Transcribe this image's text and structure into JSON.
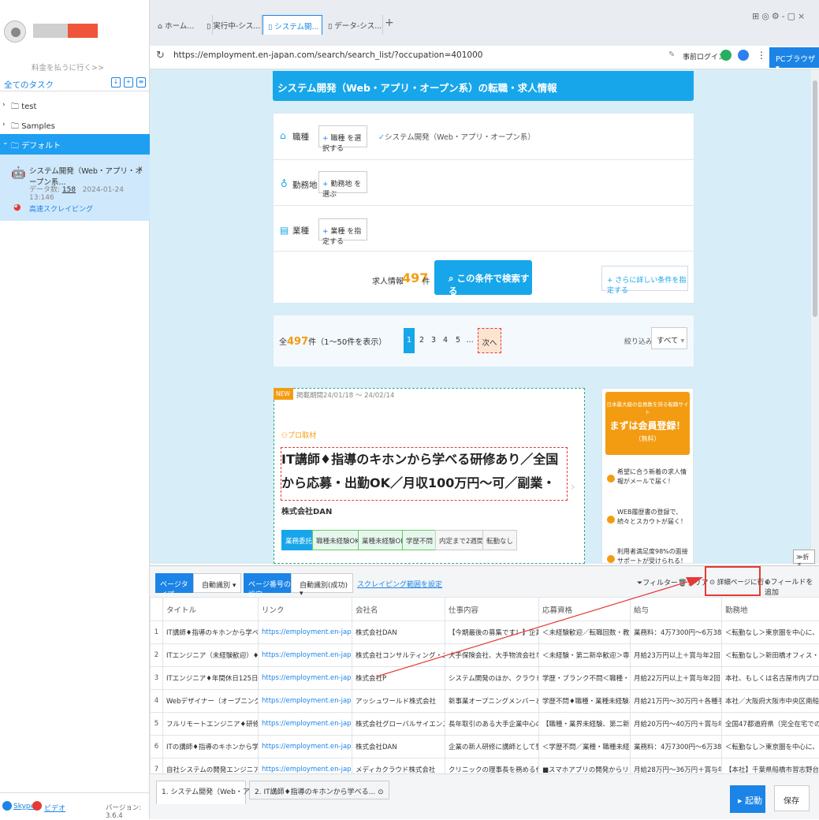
{
  "sidebar": {
    "pay_text": "料金を払うに行く>>",
    "all_tasks": "全てのタスク",
    "tree": [
      {
        "label": "test",
        "open": false
      },
      {
        "label": "Samples",
        "open": false
      },
      {
        "label": "デフォルト",
        "open": true
      }
    ],
    "task": {
      "title": "システム開発（Web・アプリ・オープン系...",
      "data_label": "データ数:",
      "data_count": "158",
      "date": "2024-01-24 13:146",
      "link": "高速スクレイピング"
    },
    "footer": {
      "skype": "Skype",
      "video": "ビデオ",
      "version": "バージョン: 3.6.4"
    }
  },
  "tabs": [
    {
      "label": "ホーム..."
    },
    {
      "label": "実行中-シス..."
    },
    {
      "label": "システム開..."
    },
    {
      "label": "データ-シス..."
    }
  ],
  "address": {
    "url": "https://employment.en-japan.com/search/search_list/?occupation=401000",
    "login": "事前ログイン",
    "browser": "PCブラウザ"
  },
  "web": {
    "title": "システム開発（Web・アプリ・オープン系）の転職・求人情報",
    "row1_label": "職種",
    "row1_btn": "職種 を選択する",
    "row1_selected": "システム開発（Web・アプリ・オープン系）",
    "row2_label": "勤務地",
    "row2_btn": "勤務地 を選ぶ",
    "row3_label": "業種",
    "row3_btn": "業種 を指定する",
    "count_label": "求人情報",
    "count": "497",
    "count_unit": "件",
    "search_btn": "この条件で検索する",
    "more_btn": "さらに詳しい条件を指定する",
    "total_prefix": "全",
    "total": "497",
    "total_suffix": "件（1～50件を表示）",
    "pages": [
      "1",
      "2",
      "3",
      "4",
      "5",
      "…",
      "次へ"
    ],
    "filter_label": "絞り込み：",
    "filter_value": "すべて",
    "new_badge": "NEW",
    "period": "掲載期間24/01/18 ～ 24/02/14",
    "pro": "プロ取材",
    "job_title": "IT講師♦指導のキホンから学べる研修あり／全国から応募・出勤OK／月収100万円～可／副業・兼業OK",
    "company": "株式会社DAN",
    "chips": [
      "業務委託",
      "職種未経験OK",
      "業種未経験OK",
      "学歴不問",
      "内定まで2週間",
      "転勤なし"
    ],
    "ad": {
      "top": "日本最大級の会員数を誇る転職サイト",
      "main": "まずは会員登録！",
      "free": "（無料）",
      "p1": "希望に合う新着の求人情報がメールで届く！",
      "p2": "WEB履歴書の登録で、続々とスカウトが届く！",
      "p3": "利用者満足度98%の面接サポートが受けられる！"
    },
    "collapse": "折る"
  },
  "toolbar": {
    "page_type_label": "ページタイプ",
    "page_type_value": "自動識別",
    "page_num_label": "ページ番号の設定",
    "page_num_value": "自動識別(成功)",
    "scrape_range": "スクレイピング範囲を設定",
    "filter": "フィルター",
    "clear": "クリア",
    "detail": "詳細ページに行く",
    "add_field": "フィールドを追加"
  },
  "table": {
    "columns": [
      "タイトル",
      "リンク",
      "会社名",
      "仕事内容",
      "応募資格",
      "給与",
      "勤務地"
    ],
    "rows": [
      [
        "1",
        "IT講師♦指導のキホンから学べる研修...",
        "https://employment.en-japan.com/de...",
        "株式会社DAN",
        "【今期最後の募集です！】企業の新...",
        "＜未経験歓迎／転職回数・教育ブラ...",
        "業務料：4万7300円～6万3800円／...",
        "＜転勤なし＞東京圏を中心に、大阪..."
      ],
      [
        "2",
        "ITエンジニア（未経験歓迎）♦充実の...",
        "https://employment.en-japan.com/de...",
        "株式会社コンサルティング・エムア...",
        "大手保険会社、大手物流会社などの...",
        "＜未経験・第二新卒歓迎＞専門や以...",
        "月給23万円以上＋賞与年2回＋各種手...",
        "＜転勤なし＞新田橋オフィス・小川..."
      ],
      [
        "3",
        "ITエンジニア♦年間休日125日／リモ...",
        "https://employment.en-japan.com/de...",
        "株式会社P",
        "システム開発のほか、クラウド構築...",
        "学歴・ブランク不問＜職種・業種未...",
        "月給22万円以上＋賞与年2回＋各種...",
        "本社、もしくは名古屋市内プロジェ..."
      ],
      [
        "4",
        "Webデザイナー（オープニング募集...",
        "https://employment.en-japan.com/de...",
        "アッシュワールド株式会社",
        "新事業オープニングメンバーとして...",
        "学歴不問♦職種・業種未経験、社会人...",
        "月給21万円～30万円＋各種手当 ※...",
        "本社／大阪府大阪市中央区南船場3-7..."
      ],
      [
        "5",
        "フルリモートエンジニア♦研修もリモ...",
        "https://employment.en-japan.com/de...",
        "株式会社グローバルサイエンス",
        "長年取引のある大手企業中心のシス...",
        "【職種・業界未経験、第二新卒歓迎...",
        "月給20万円～40万円＋賞与年3回＋...",
        "全国47都道府県（完全在宅での勤務..."
      ],
      [
        "6",
        "ITの講師♦指導のキホンから学べる研...",
        "https://employment.en-japan.com/de...",
        "株式会社DAN",
        "企業の新人研修に講師として登壇し...",
        "＜学歴不問／業種・職種未経験、第...",
        "業務料：4万7300円～6万3800円／...",
        "＜転勤なし＞東京圏を中心に、大阪..."
      ],
      [
        "7",
        "自社システムの開発エンジニア♦年間...",
        "https://employment.en-japan.com/de...",
        "メディカクラウド株式会社",
        "クリニックの理事長を務める代表が...",
        "■スマホアプリの開発からリリースま...",
        "月給28万円～36万円＋賞与年3回＜...",
        "【本社】千葉県船橋市習志野台8丁目..."
      ]
    ]
  },
  "bottom": {
    "tab1": "1. システム開発（Web・アプリ・...",
    "tab2": "2. IT講師♦指導のキホンから学べる...",
    "run": "起動",
    "save": "保存"
  },
  "colors": {
    "accent": "#1b84e6",
    "site_blue": "#17a6ea",
    "highlight_red": "#e53935"
  }
}
